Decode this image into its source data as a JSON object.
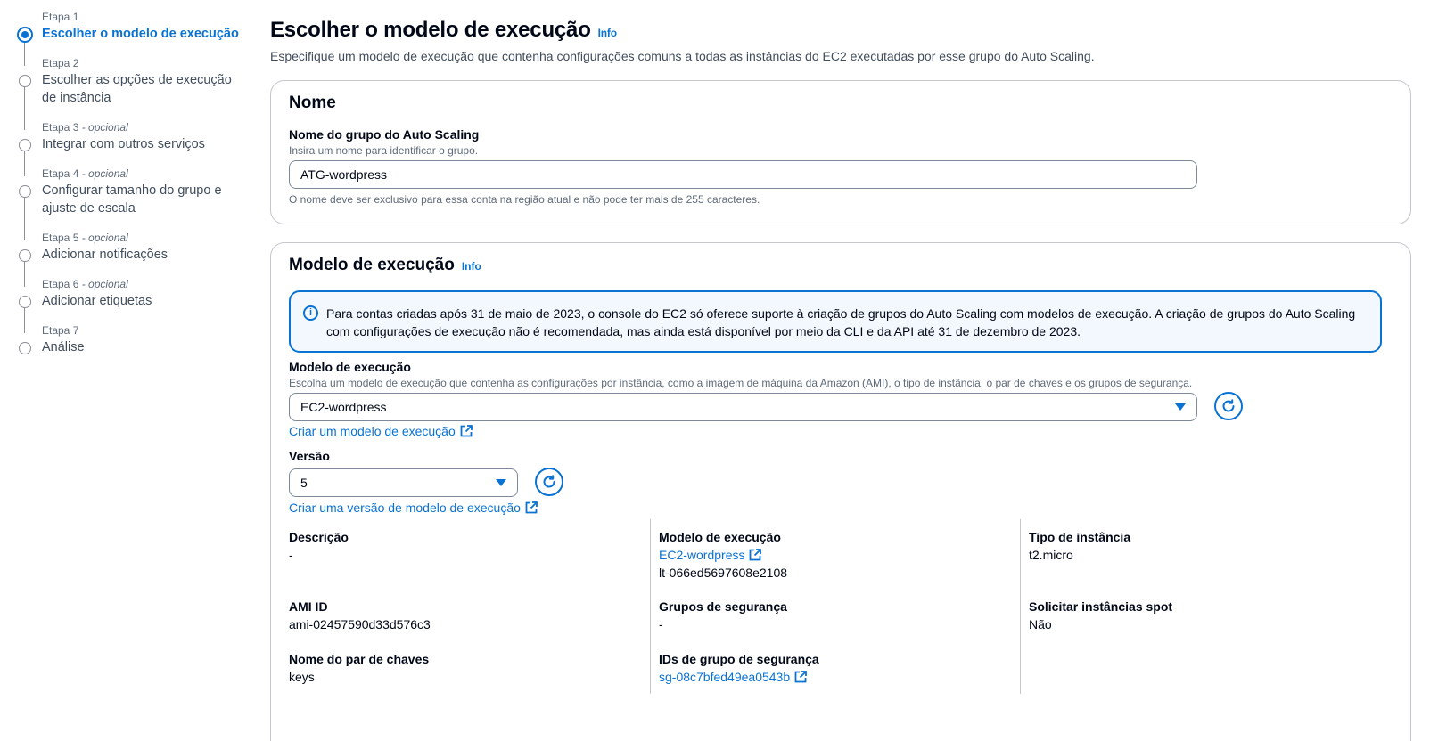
{
  "steps": [
    {
      "num": "Etapa 1",
      "optional": "",
      "title": "Escolher o modelo de execução"
    },
    {
      "num": "Etapa 2",
      "optional": "",
      "title": "Escolher as opções de execução de instância"
    },
    {
      "num": "Etapa 3",
      "optional": " - opcional",
      "title": "Integrar com outros serviços"
    },
    {
      "num": "Etapa 4",
      "optional": " - opcional",
      "title": "Configurar tamanho do grupo e ajuste de escala"
    },
    {
      "num": "Etapa 5",
      "optional": " - opcional",
      "title": "Adicionar notificações"
    },
    {
      "num": "Etapa 6",
      "optional": " - opcional",
      "title": "Adicionar etiquetas"
    },
    {
      "num": "Etapa 7",
      "optional": "",
      "title": "Análise"
    }
  ],
  "header": {
    "title": "Escolher o modelo de execução",
    "info": "Info",
    "description": "Especifique um modelo de execução que contenha configurações comuns a todas as instâncias do EC2 executadas por esse grupo do Auto Scaling."
  },
  "name_section": {
    "title": "Nome",
    "field_label": "Nome do grupo do Auto Scaling",
    "field_hint": "Insira um nome para identificar o grupo.",
    "field_value": "ATG-wordpress",
    "constraint": "O nome deve ser exclusivo para essa conta na região atual e não pode ter mais de 255 caracteres."
  },
  "template_section": {
    "title": "Modelo de execução",
    "info": "Info",
    "alert": "Para contas criadas após 31 de maio de 2023, o console do EC2 só oferece suporte à criação de grupos do Auto Scaling com modelos de execução. A criação de grupos do Auto Scaling com configurações de execução não é recomendada, mas ainda está disponível por meio da CLI e da API até 31 de dezembro de 2023.",
    "template_label": "Modelo de execução",
    "template_hint": "Escolha um modelo de execução que contenha as configurações por instância, como a imagem de máquina da Amazon (AMI), o tipo de instância, o par de chaves e os grupos de segurança.",
    "template_value": "EC2-wordpress",
    "create_template_link": "Criar um modelo de execução",
    "version_label": "Versão",
    "version_value": "5",
    "create_version_link": "Criar uma versão de modelo de execução",
    "details": {
      "description_k": "Descrição",
      "description_v": "-",
      "ami_k": "AMI ID",
      "ami_v": "ami-02457590d33d576c3",
      "keypair_k": "Nome do par de chaves",
      "keypair_v": "keys",
      "template_k": "Modelo de execução",
      "template_link": "EC2-wordpress",
      "template_id": "lt-066ed5697608e2108",
      "sg_k": "Grupos de segurança",
      "sg_v": "-",
      "sg_ids_k": "IDs de grupo de segurança",
      "sg_ids_v": "sg-08c7bfed49ea0543b",
      "instance_type_k": "Tipo de instância",
      "instance_type_v": "t2.micro",
      "spot_k": "Solicitar instâncias spot",
      "spot_v": "Não"
    }
  },
  "colors": {
    "accent": "#0972d3",
    "text": "#000716",
    "muted": "#5f6b7a",
    "border": "#c6c6cd",
    "alert_bg": "#f2f8fd"
  },
  "icons": {
    "info": "info-circle-icon",
    "external": "external-link-icon",
    "refresh": "refresh-icon",
    "caret": "caret-down-icon"
  }
}
